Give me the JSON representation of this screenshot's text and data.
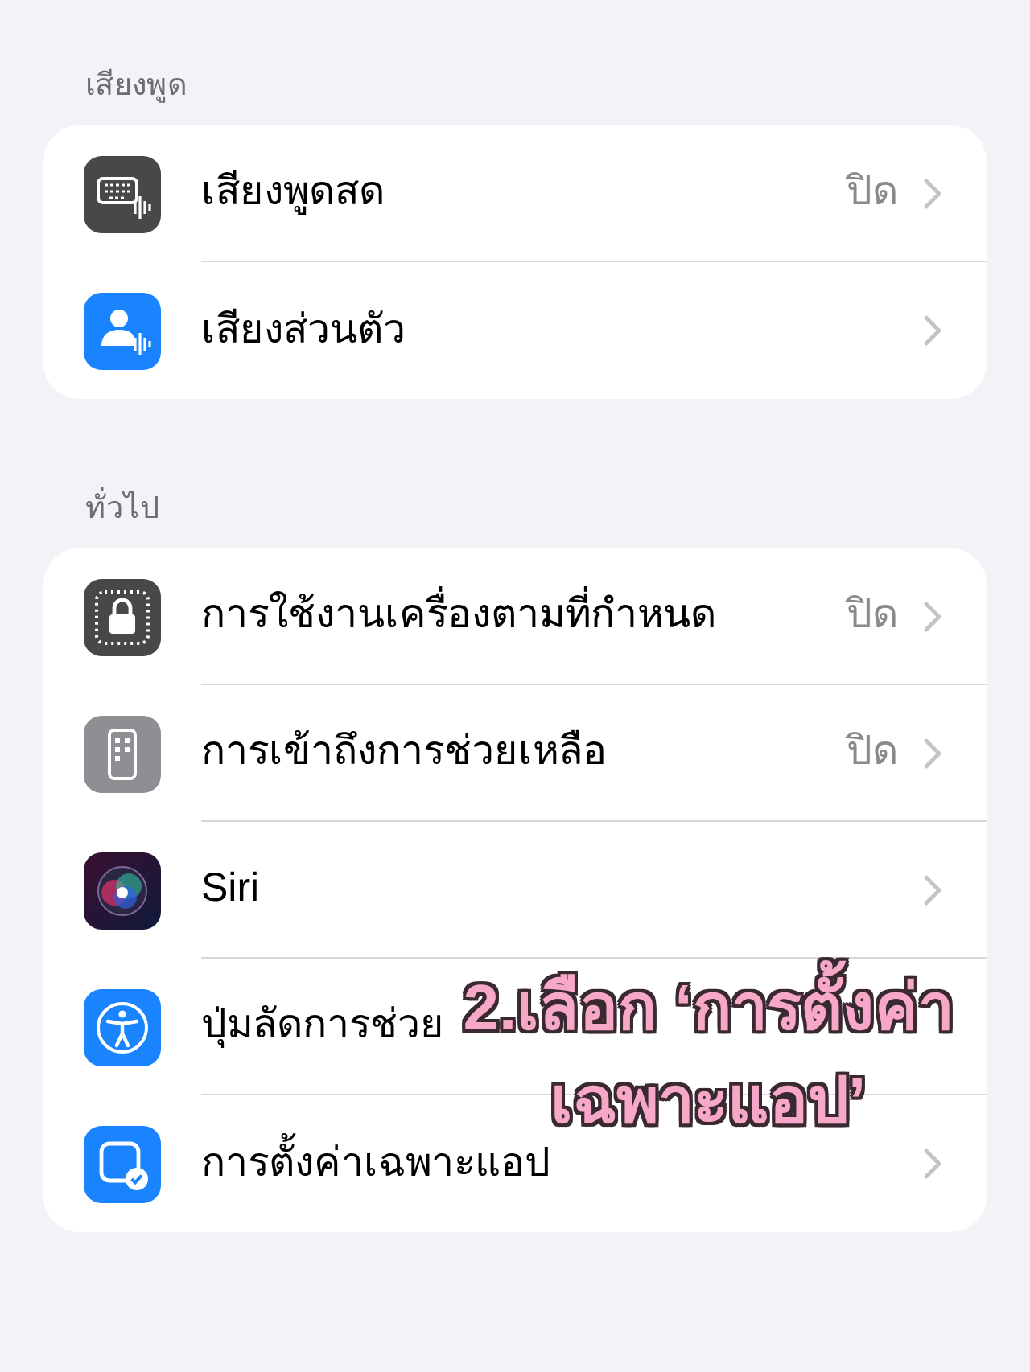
{
  "sections": [
    {
      "header": "เสียงพูด",
      "rows": [
        {
          "kind": "keyboard-wave",
          "label": "เสียงพูดสด",
          "value": "ปิด",
          "chevron": true
        },
        {
          "kind": "person-wave",
          "label": "เสียงส่วนตัว",
          "chevron": true
        }
      ]
    },
    {
      "header": "ทั่วไป",
      "rows": [
        {
          "kind": "lock",
          "label": "การใช้งานเครื่องตามที่กำหนด",
          "value": "ปิด",
          "chevron": true
        },
        {
          "kind": "remote",
          "label": "การเข้าถึงการช่วยเหลือ",
          "value": "ปิด",
          "chevron": true
        },
        {
          "kind": "siri",
          "label": "Siri",
          "chevron": true
        },
        {
          "kind": "accessibility",
          "label": "ปุ่มลัดการช่วย",
          "chevron": false
        },
        {
          "kind": "app-check",
          "label": "การตั้งค่าเฉพาะแอป",
          "chevron": true
        }
      ]
    }
  ],
  "annotation": {
    "lines": [
      "2.เลือก ‘การตั้งค่า",
      "เฉพาะแอป’"
    ]
  }
}
